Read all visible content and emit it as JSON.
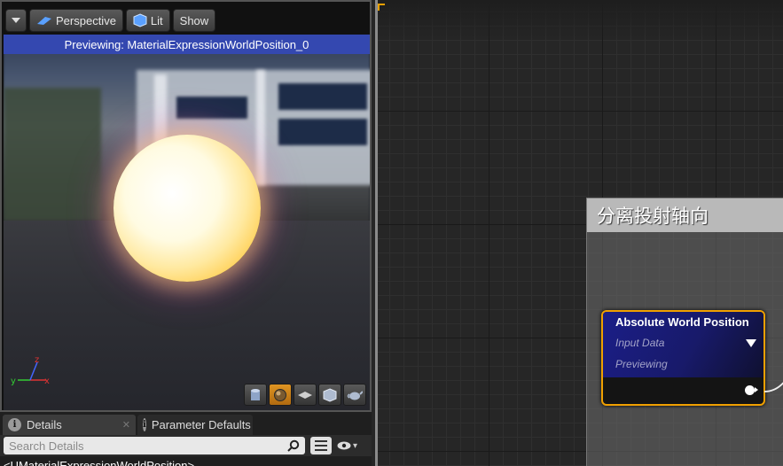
{
  "viewport": {
    "toolbar": {
      "dropdown_icon": "chevron-down-icon",
      "perspective_label": "Perspective",
      "lit_label": "Lit",
      "show_label": "Show"
    },
    "preview_banner": "Previewing: MaterialExpressionWorldPosition_0",
    "axis_labels": {
      "x": "x",
      "y": "y",
      "z": "z"
    },
    "preview_shapes": [
      "cylinder-icon",
      "sphere-icon",
      "plane-icon",
      "cube-icon",
      "teapot-icon"
    ],
    "active_shape": "sphere-icon"
  },
  "details": {
    "tabs": [
      {
        "label": "Details",
        "icon": "info-icon"
      },
      {
        "label": "Parameter Defaults",
        "icon": "info-icon"
      }
    ],
    "search_placeholder": "Search Details",
    "cutoff_label": "<UMaterialExpressionWorldPosition>"
  },
  "graph": {
    "comment_title": "分离投射轴向",
    "node": {
      "title": "Absolute World Position",
      "input_label": "Input Data",
      "status": "Previewing"
    },
    "colors": {
      "accent": "#f0a000",
      "banner": "#3448b0",
      "node_header": "#1b1e88"
    }
  }
}
